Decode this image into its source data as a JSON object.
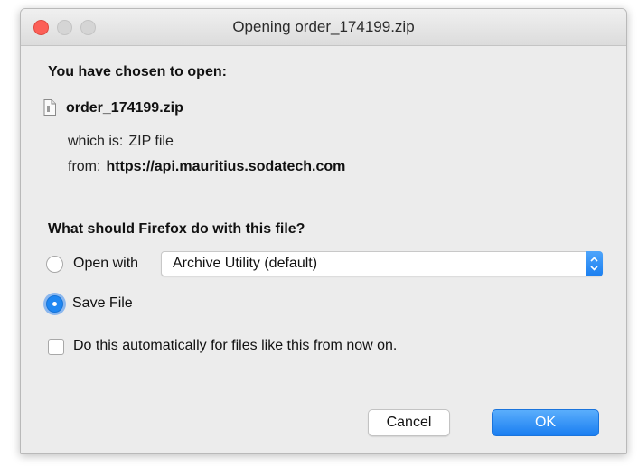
{
  "window": {
    "title": "Opening order_174199.zip"
  },
  "dialog": {
    "heading": "You have chosen to open:",
    "file_name": "order_174199.zip",
    "type_label": "which is:",
    "type_value": "ZIP file",
    "from_label": "from:",
    "from_value": "https://api.mauritius.sodatech.com",
    "question": "What should Firefox do with this file?",
    "open_with_label": "Open with",
    "open_with_selected": "Archive Utility (default)",
    "save_file_label": "Save File",
    "selected_option": "Save File",
    "auto_checkbox_label": "Do this automatically for files like this from now on.",
    "auto_checkbox_checked": false,
    "cancel_label": "Cancel",
    "ok_label": "OK"
  },
  "icons": {
    "file": "document-icon",
    "select_arrows": "up-down-chevron-icon"
  },
  "colors": {
    "accent": "#1f87f2",
    "close_button": "#fc5f57",
    "dialog_bg": "#ececec"
  }
}
